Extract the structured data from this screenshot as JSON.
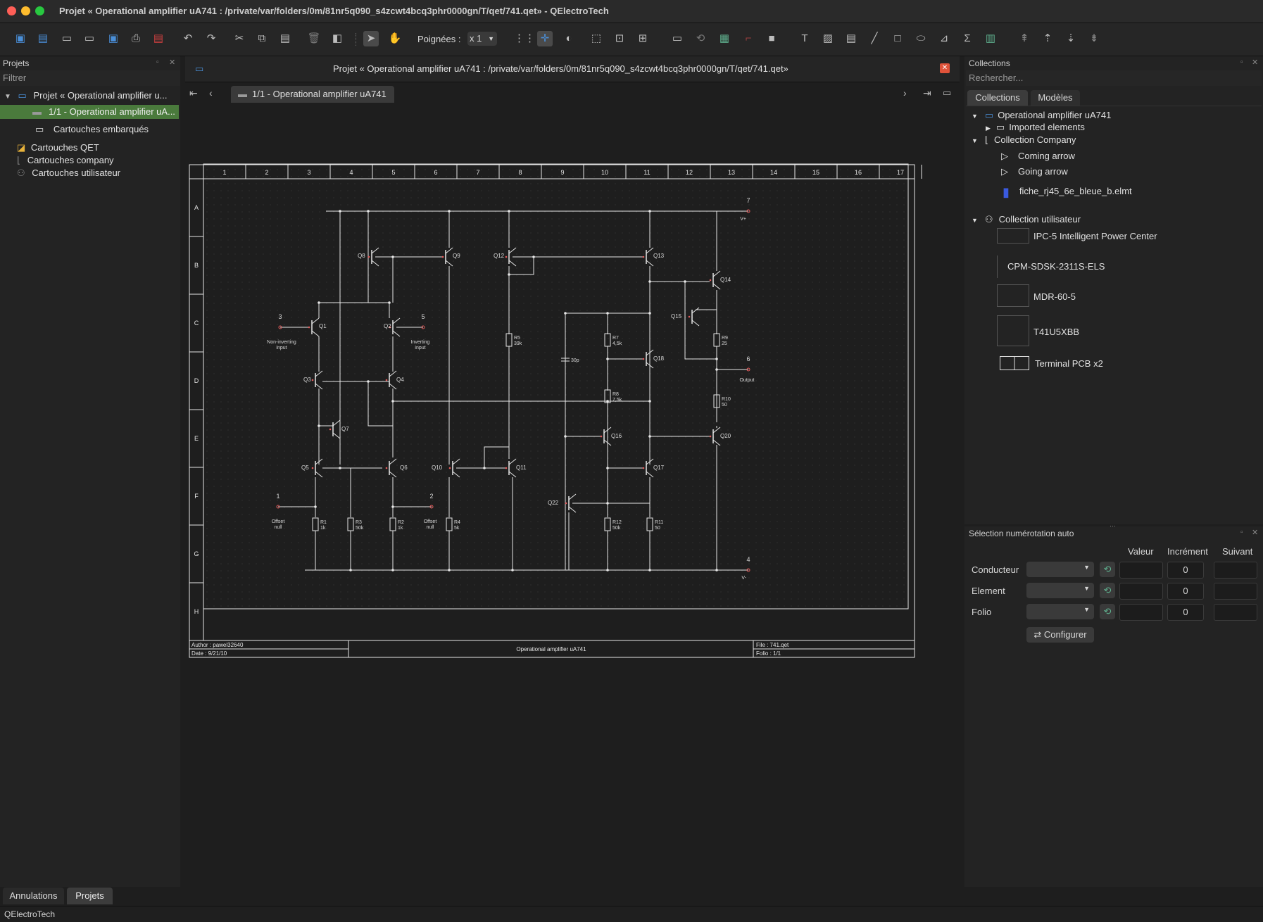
{
  "window": {
    "title": "Projet « Operational amplifier uA741 : /private/var/folders/0m/81nr5q090_s4zcwt4bcq3phr0000gn/T/qet/741.qet» - QElectroTech"
  },
  "toolbar": {
    "handles_label": "Poignées :",
    "handles_value": "x 1"
  },
  "left_panel": {
    "title": "Projets",
    "filter_placeholder": "Filtrer",
    "project_label": "Projet « Operational amplifier u...",
    "folio_label": "1/1 - Operational amplifier uA...",
    "embedded_label": "Cartouches embarqués",
    "qet_label": "Cartouches QET",
    "company_label": "Cartouches company",
    "user_label": "Cartouches utilisateur"
  },
  "editor": {
    "title": "Projet « Operational amplifier uA741 : /private/var/folders/0m/81nr5q090_s4zcwt4bcq3phr0000gn/T/qet/741.qet»",
    "tab_label": "1/1 - Operational amplifier uA741"
  },
  "diagram": {
    "columns": [
      "1",
      "2",
      "3",
      "4",
      "5",
      "6",
      "7",
      "8",
      "9",
      "10",
      "11",
      "12",
      "13",
      "14",
      "15",
      "16",
      "17"
    ],
    "rows": [
      "A",
      "B",
      "C",
      "D",
      "E",
      "F",
      "G",
      "H"
    ],
    "labels": {
      "Q1": "Q1",
      "Q2": "Q2",
      "Q3": "Q3",
      "Q4": "Q4",
      "Q5": "Q5",
      "Q6": "Q6",
      "Q7": "Q7",
      "Q8": "Q8",
      "Q9": "Q9",
      "Q10": "Q10",
      "Q11": "Q11",
      "Q12": "Q12",
      "Q13": "Q13",
      "Q14": "Q14",
      "Q15": "Q15",
      "Q16": "Q16",
      "Q17": "Q17",
      "Q18": "Q18",
      "Q20": "Q20",
      "Q22": "Q22",
      "R1": "R1",
      "R1v": "1k",
      "R2": "R2",
      "R2v": "1k",
      "R3": "R3",
      "R3v": "50k",
      "R4": "R4",
      "R4v": "5k",
      "R5": "R5",
      "R5v": "39k",
      "R7": "R7",
      "R7v": "4,5k",
      "R8": "R8",
      "R8v": "7,5k",
      "R9": "R9",
      "R9v": "25",
      "R10": "R10",
      "R10v": "50",
      "R11": "R11",
      "R11v": "50",
      "R12": "R12",
      "R12v": "50k",
      "C": "30p",
      "p1": "1",
      "p2": "2",
      "p3": "3",
      "p4": "4",
      "p5": "5",
      "p6": "6",
      "p7": "7",
      "vplus": "V+",
      "vminus": "V-",
      "output": "Output",
      "noninv1": "Non-inverting",
      "noninv2": "input",
      "inv1": "Inverting",
      "inv2": "input",
      "off1a": "Offset",
      "off1b": "null",
      "off2a": "Offset",
      "off2b": "null"
    },
    "titleblock": {
      "author": "Author : pawel32640",
      "date": "Date : 9/21/10",
      "title": "Operational amplifier uA741",
      "file": "File : 741.qet",
      "folio": "Folio : 1/1"
    }
  },
  "right_panel": {
    "title": "Collections",
    "search_placeholder": "Rechercher...",
    "tab_collections": "Collections",
    "tab_models": "Modèles",
    "items": {
      "project": "Operational amplifier uA741",
      "imported": "Imported elements",
      "company": "Collection Company",
      "coming": "Coming arrow",
      "going": "Going arrow",
      "rj45": "fiche_rj45_6e_bleue_b.elmt",
      "user": "Collection utilisateur",
      "ipc": "IPC-5 Intelligent Power Center",
      "cpm": "CPM-SDSK-2311S-ELS",
      "mdr": "MDR-60-5",
      "t41": "T41U5XBB",
      "terminal": "Terminal PCB x2"
    }
  },
  "autonum": {
    "title": "Sélection numérotation auto",
    "col_value": "Valeur",
    "col_increment": "Incrément",
    "col_next": "Suivant",
    "row_conductor": "Conducteur",
    "row_element": "Element",
    "row_folio": "Folio",
    "inc_conductor": "0",
    "inc_element": "0",
    "inc_folio": "0",
    "configure": "Configurer"
  },
  "bottom_tabs": {
    "annulations": "Annulations",
    "projets": "Projets"
  },
  "status": {
    "text": "QElectroTech"
  }
}
